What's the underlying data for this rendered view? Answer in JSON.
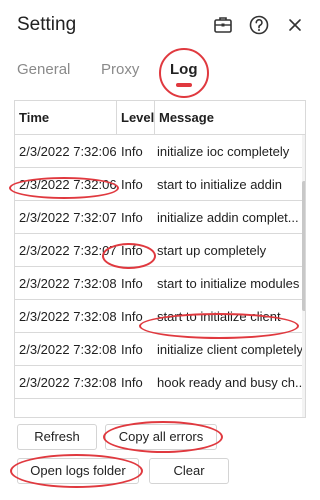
{
  "window": {
    "title": "Setting"
  },
  "toolbar_icons": [
    "briefcase-icon",
    "help-icon",
    "close-icon"
  ],
  "tabs": [
    {
      "label": "General",
      "active": false
    },
    {
      "label": "Proxy",
      "active": false
    },
    {
      "label": "Log",
      "active": true
    }
  ],
  "table": {
    "headers": {
      "time": "Time",
      "level": "Level",
      "message": "Message"
    },
    "rows": [
      {
        "time": "2/3/2022 7:32:06",
        "level": "Info",
        "message": "initialize ioc completely"
      },
      {
        "time": "2/3/2022 7:32:06",
        "level": "Info",
        "message": "start to initialize addin"
      },
      {
        "time": "2/3/2022 7:32:07",
        "level": "Info",
        "message": "initialize addin complet..."
      },
      {
        "time": "2/3/2022 7:32:07",
        "level": "Info",
        "message": "start up completely"
      },
      {
        "time": "2/3/2022 7:32:08",
        "level": "Info",
        "message": "start to initialize modules"
      },
      {
        "time": "2/3/2022 7:32:08",
        "level": "Info",
        "message": "start to initialize client"
      },
      {
        "time": "2/3/2022 7:32:08",
        "level": "Info",
        "message": "initialize client completely"
      },
      {
        "time": "2/3/2022 7:32:08",
        "level": "Info",
        "message": "hook ready and busy ch..."
      }
    ]
  },
  "buttons": {
    "refresh": "Refresh",
    "copy_all_errors": "Copy all errors",
    "open_logs_folder": "Open logs folder",
    "clear": "Clear"
  },
  "colors": {
    "accent": "#e0393f",
    "border": "#d9d9d9",
    "muted_text": "#8a8a8a"
  }
}
